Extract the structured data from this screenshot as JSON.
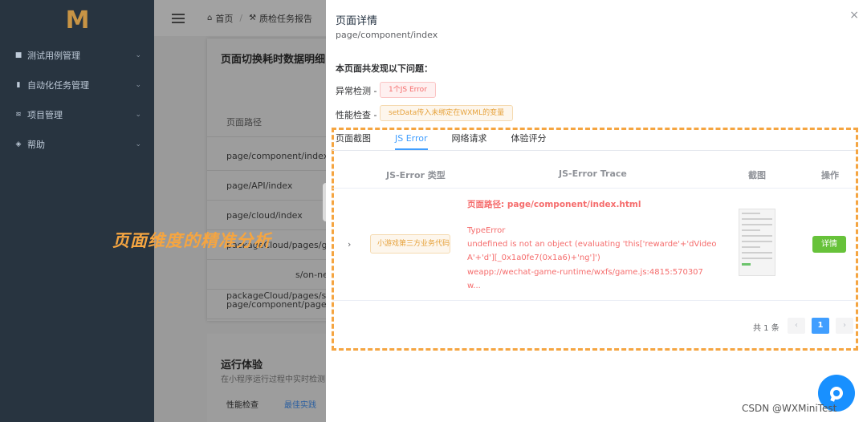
{
  "sidebar": {
    "logo": "M",
    "items": [
      {
        "label": "测试用例管理",
        "icon": "folder-icon",
        "glyph": "■"
      },
      {
        "label": "自动化任务管理",
        "icon": "bar-chart-icon",
        "glyph": "▮"
      },
      {
        "label": "项目管理",
        "icon": "layers-icon",
        "glyph": "≋"
      },
      {
        "label": "帮助",
        "icon": "help-icon",
        "glyph": "◈"
      }
    ],
    "chevron": "⌄"
  },
  "navbar": {
    "home": "首页",
    "report": "质检任务报告",
    "sep": "/"
  },
  "left_card": {
    "title": "页面切换耗时数据明细",
    "header": "页面路径",
    "rows": [
      "page/component/index",
      "page/API/index",
      "page/cloud/index",
      "packageCloud/pages/get-",
      "s/on-ne",
      "packageCloud/pages/rnd",
      "page/component/pages/p",
      "packageCloud/pages/scf-"
    ]
  },
  "run_card": {
    "title": "运行体验",
    "subtitle": "在小程序运行过程中实时检测",
    "btn1": "性能检查",
    "btn2": "最佳实践"
  },
  "overlay": {
    "text": "页面维度的精准分析"
  },
  "drawer": {
    "title": "页面详情",
    "path": "page/component/index",
    "close": "×",
    "issues_title": "本页面共发现以下问题：",
    "anomaly_label": "异常检测 -",
    "anomaly_tag": "1个JS Error",
    "perf_label": "性能检查 -",
    "perf_tag": "setData传入未绑定在WXML的变量",
    "tabs": [
      "页面截图",
      "JS Error",
      "网络请求",
      "体验评分"
    ],
    "active_tab": 1,
    "table": {
      "headers": [
        "JS-Error 类型",
        "JS-Error Trace",
        "截图",
        "操作"
      ],
      "row": {
        "expand": "›",
        "type": "小游戏第三方业务代码错误",
        "trace_path": "页面路径: page/component/index.html",
        "trace_lines": [
          "TypeError",
          "undefined is not an object (evaluating 'this['rewarde'+'dVideo",
          "A'+'d'][_0x1a0fe7(0x1a6)+'ng']')",
          "weapp://wechat-game-runtime/wxfs/game.js:4815:570307",
          "w..."
        ],
        "action": "详情"
      }
    },
    "pagination": {
      "total": "共 1 条",
      "prev": "‹",
      "current": "1",
      "next": "›"
    }
  },
  "watermark": "CSDN @WXMiniTest",
  "colors": {
    "accent": "#409eff",
    "orange": "#f5a541",
    "error": "#f56c6c",
    "success": "#67c23a",
    "sidebar_bg": "#283440"
  }
}
